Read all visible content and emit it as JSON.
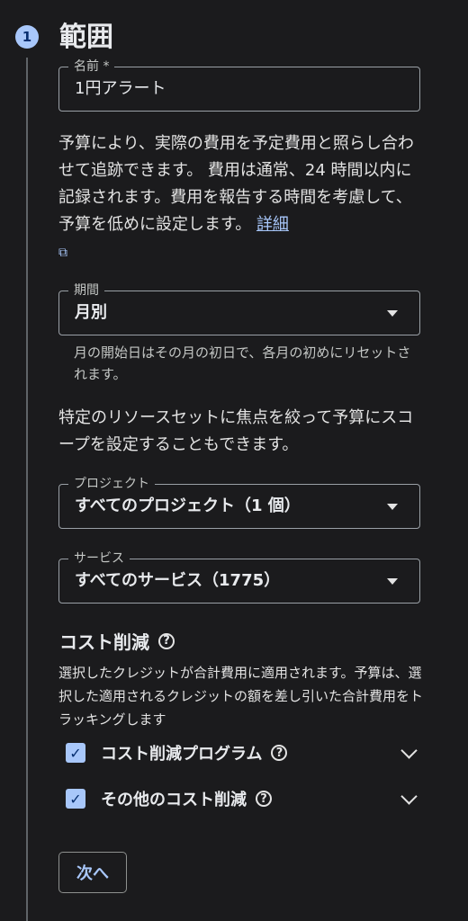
{
  "step": {
    "number": "1",
    "title": "範囲"
  },
  "name_field": {
    "label": "名前 *",
    "value": "1円アラート"
  },
  "intro": {
    "text": "予算により、実際の費用を予定費用と照らし合わせて追跡できます。 費用は通常、24 時間以内に記録されます。費用を報告する時間を考慮して、予算を低めに設定します。",
    "link": "詳細",
    "link_icon": "external-link-icon"
  },
  "period": {
    "label": "期間",
    "value": "月別",
    "hint": "月の開始日はその月の初日で、各月の初めにリセットされます。"
  },
  "scope_text": "特定のリソースセットに焦点を絞って予算にスコープを設定することもできます。",
  "project": {
    "label": "プロジェクト",
    "value": "すべてのプロジェクト（1 個）"
  },
  "service": {
    "label": "サービス",
    "value": "すべてのサービス（1775）"
  },
  "savings": {
    "title": "コスト削減",
    "description": "選択したクレジットが合計費用に適用されます。予算は、選択した適用されるクレジットの額を差し引いた合計費用をトラッキングします",
    "items": [
      {
        "label": "コスト削減プログラム",
        "checked": true
      },
      {
        "label": "その他のコスト削減",
        "checked": true
      }
    ]
  },
  "next_button": "次へ",
  "colors": {
    "accent": "#a8c7fa",
    "background": "#1b1b1d"
  }
}
